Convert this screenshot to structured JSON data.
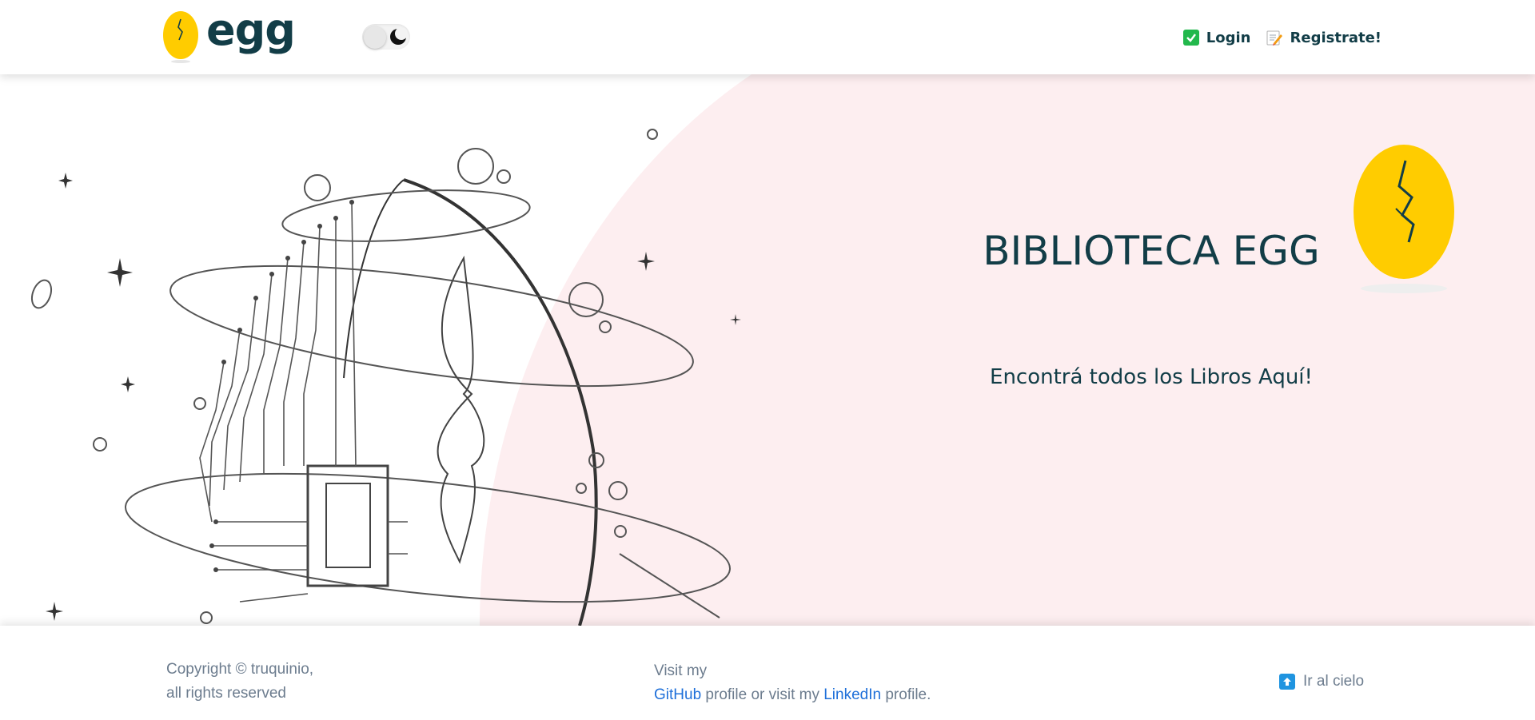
{
  "header": {
    "brand_text": "egg",
    "nav": {
      "login_label": "Login",
      "register_label": "Registrate!"
    },
    "theme_toggle": {
      "state": "light",
      "icon": "moon-icon"
    }
  },
  "hero": {
    "title": "BIBLIOTECA EGG",
    "subtitle": "Encontrá todos los Libros Aquí!"
  },
  "footer": {
    "copyright_line1": "Copyright © truquinio,",
    "copyright_line2": "all rights reserved",
    "visit_prefix": "Visit my",
    "github_label": "GitHub",
    "visit_middle": " profile or visit my ",
    "linkedin_label": "LinkedIn",
    "visit_suffix": " profile.",
    "to_top_label": "Ir al cielo"
  },
  "colors": {
    "brand_dark": "#123d47",
    "egg_yellow": "#ffcc00",
    "hero_pink": "#fdeef0",
    "link_blue": "#1e6fd9",
    "login_green": "#22b84c",
    "footer_text": "#6c7c8e"
  }
}
